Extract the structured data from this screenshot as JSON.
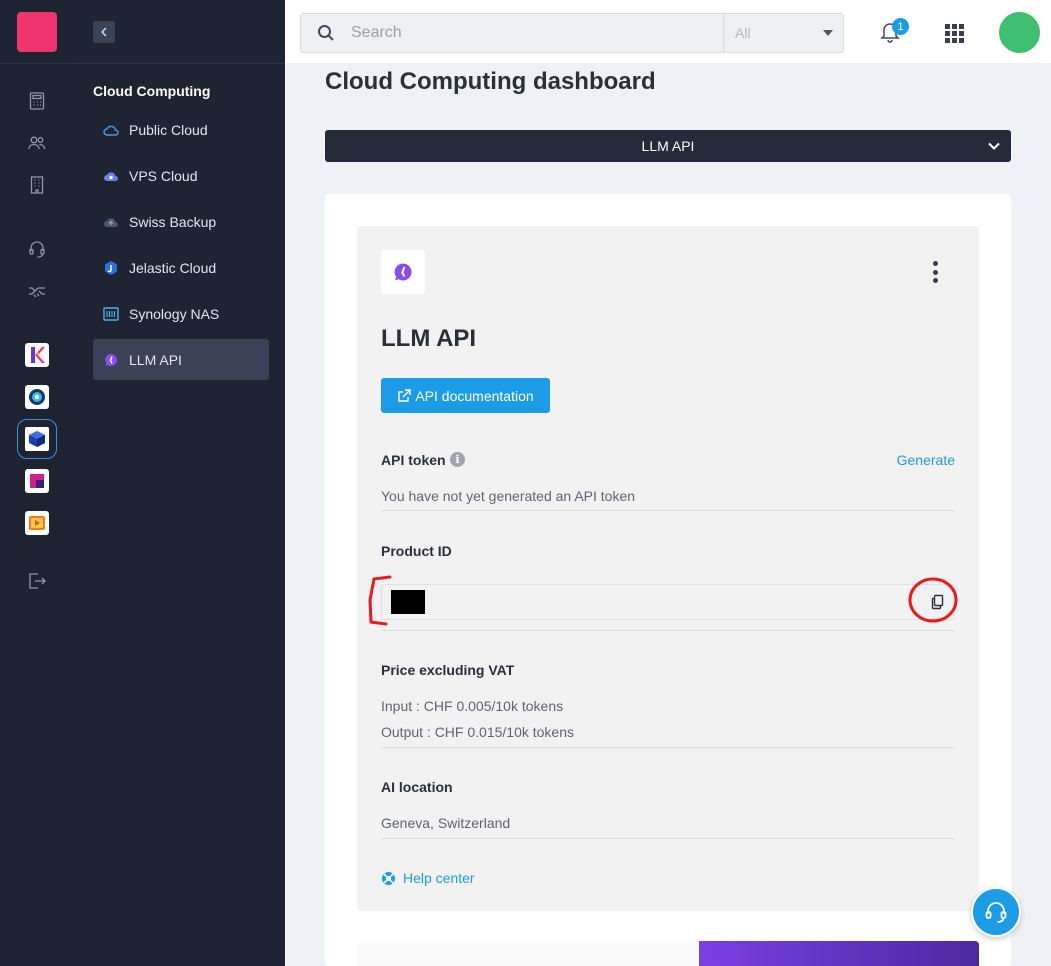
{
  "colors": {
    "accent": "#1c9be6",
    "brand": "#ef3470",
    "sidebar_bg": "#1f2433",
    "rail_bg": "#1e2331",
    "avatar": "#3fbf6f",
    "promo_gradient": "#7a3fe4"
  },
  "rail": {
    "icons": [
      "calculator-icon",
      "users-icon",
      "building-icon",
      "headset-icon",
      "handshake-icon",
      "logout-icon"
    ],
    "apps": [
      "kchat-app-icon",
      "kdrive-app-icon",
      "cloud-computing-app-icon",
      "ksuite-app-icon",
      "kplayer-app-icon"
    ]
  },
  "sidebar": {
    "section_title": "Cloud Computing",
    "items": [
      {
        "label": "Public Cloud",
        "icon": "cloud-icon"
      },
      {
        "label": "VPS Cloud",
        "icon": "vps-icon"
      },
      {
        "label": "Swiss Backup",
        "icon": "backup-icon"
      },
      {
        "label": "Jelastic Cloud",
        "icon": "jelastic-icon"
      },
      {
        "label": "Synology NAS",
        "icon": "nas-icon"
      },
      {
        "label": "LLM API",
        "icon": "llm-icon",
        "active": true
      }
    ]
  },
  "topbar": {
    "search_placeholder": "Search",
    "filter_value": "All",
    "notification_count": "1"
  },
  "main": {
    "page_title": "Cloud Computing dashboard",
    "product_selector": "LLM API",
    "card": {
      "title": "LLM API",
      "doc_button": "API documentation",
      "api_token": {
        "label": "API token",
        "action": "Generate",
        "value": "You have not yet generated an API token"
      },
      "product_id": {
        "label": "Product ID"
      },
      "price": {
        "label": "Price excluding VAT",
        "input": "Input : CHF 0.005/10k tokens",
        "output": "Output : CHF 0.015/10k tokens"
      },
      "location": {
        "label": "AI location",
        "value": "Geneva, Switzerland"
      },
      "help_link": "Help center"
    }
  }
}
